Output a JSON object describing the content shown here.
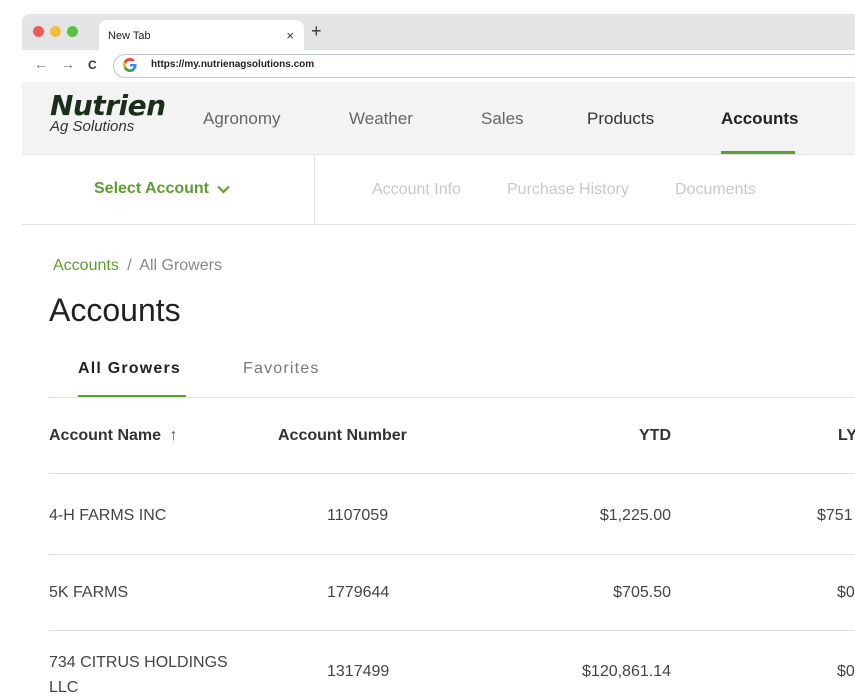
{
  "browser": {
    "tab_title": "New Tab",
    "tab_close": "×",
    "new_tab": "+",
    "back": "←",
    "forward": "→",
    "reload": "C",
    "url": "https://my.nutrienagsolutions.com"
  },
  "brand": {
    "name": "Nutrien",
    "tagline": "Ag Solutions",
    "accent_color": "#5e9e2f"
  },
  "nav": {
    "items": [
      "Agronomy",
      "Weather",
      "Sales",
      "Products",
      "Accounts"
    ],
    "active": "Accounts"
  },
  "subnav": {
    "select_account": "Select Account",
    "links": [
      "Account Info",
      "Purchase History",
      "Documents"
    ]
  },
  "breadcrumb": {
    "link": "Accounts",
    "separator": "/",
    "current": "All Growers"
  },
  "page_title": "Accounts",
  "tabs": [
    "All Growers",
    "Favorites"
  ],
  "table": {
    "headers": {
      "name": "Account Name",
      "sort_icon": "↑",
      "number": "Account Number",
      "ytd": "YTD",
      "ly": "LY"
    },
    "rows": [
      {
        "name": "4-H FARMS INC",
        "number": "1107059",
        "ytd": "$1,225.00",
        "ly": "$751"
      },
      {
        "name": "5K FARMS",
        "number": "1779644",
        "ytd": "$705.50",
        "ly": "$0"
      },
      {
        "name_line1": "734 CITRUS HOLDINGS",
        "name_line2": "LLC",
        "number": "1317499",
        "ytd": "$120,861.14",
        "ly": "$0"
      }
    ]
  }
}
